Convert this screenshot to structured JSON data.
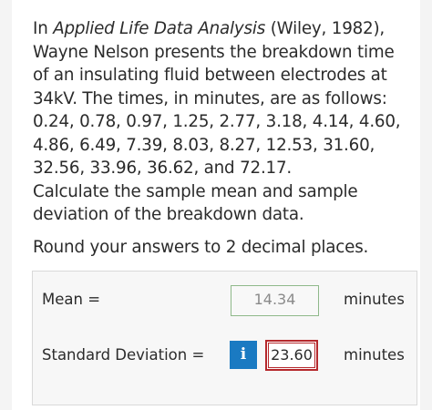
{
  "question": {
    "intro_prefix": "In ",
    "book_title": "Applied Life Data Analysis",
    "intro_rest": " (Wiley, 1982), Wayne Nelson presents the breakdown time of an insulating fluid between electrodes at 34kV. The times, in minutes, are as follows:",
    "data_line": "0.24, 0.78, 0.97, 1.25, 2.77, 3.18, 4.14, 4.60, 4.86, 6.49, 7.39, 8.03, 8.27, 12.53, 31.60, 32.56, 33.96, 36.62, and 72.17.",
    "task": "Calculate the sample mean and sample deviation of the breakdown data.",
    "round_note": "Round your answers to 2 decimal places."
  },
  "answers": {
    "mean_label": "Mean =",
    "mean_value": "14.34",
    "mean_unit": "minutes",
    "sd_label": "Standard Deviation =",
    "sd_value": "23.60",
    "sd_unit": "minutes",
    "info_icon": "i"
  }
}
